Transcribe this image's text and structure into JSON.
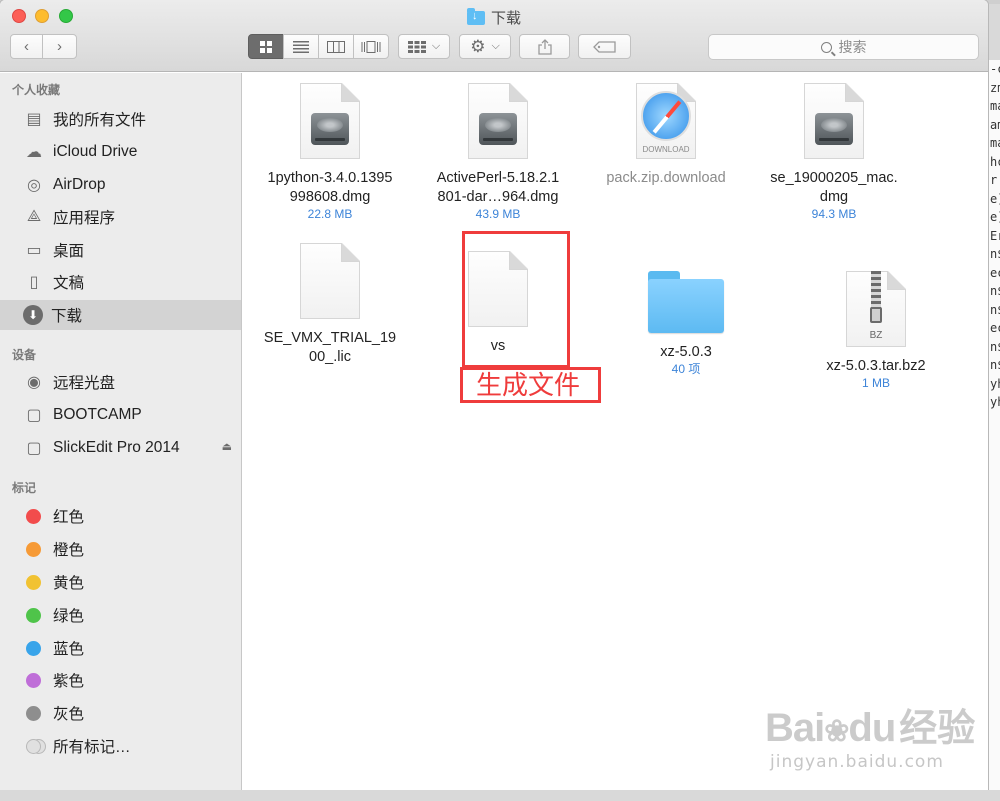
{
  "window": {
    "title": "下载"
  },
  "terminal_lines": [
    "",
    "",
    "",
    "-c",
    "zm",
    "ma",
    "am",
    "",
    "ma",
    "hc",
    "r",
    "e]",
    "e]",
    "Er",
    "n$",
    "ec",
    "n$",
    "",
    "n$",
    "ec",
    "n$",
    "",
    "n$",
    "yh",
    "yh"
  ],
  "search": {
    "placeholder": "搜索"
  },
  "sidebar": {
    "favorites_header": "个人收藏",
    "favorites": [
      {
        "label": "我的所有文件",
        "icon": "all-files-icon"
      },
      {
        "label": "iCloud Drive",
        "icon": "cloud-icon"
      },
      {
        "label": "AirDrop",
        "icon": "airdrop-icon"
      },
      {
        "label": "应用程序",
        "icon": "applications-icon"
      },
      {
        "label": "桌面",
        "icon": "desktop-icon"
      },
      {
        "label": "文稿",
        "icon": "documents-icon"
      },
      {
        "label": "下载",
        "icon": "download-icon",
        "selected": true
      }
    ],
    "devices_header": "设备",
    "devices": [
      {
        "label": "远程光盘",
        "icon": "disc-icon"
      },
      {
        "label": "BOOTCAMP",
        "icon": "drive-icon"
      },
      {
        "label": "SlickEdit Pro 2014",
        "icon": "drive-icon",
        "eject": true
      }
    ],
    "tags_header": "标记",
    "tags": [
      {
        "label": "红色",
        "color": "#f24c4c"
      },
      {
        "label": "橙色",
        "color": "#f69a36"
      },
      {
        "label": "黄色",
        "color": "#f1c232"
      },
      {
        "label": "绿色",
        "color": "#4fc44a"
      },
      {
        "label": "蓝色",
        "color": "#38a4ea"
      },
      {
        "label": "紫色",
        "color": "#bf6ed8"
      },
      {
        "label": "灰色",
        "color": "#8e8e8e"
      },
      {
        "label": "所有标记…",
        "color": ""
      }
    ]
  },
  "files": [
    {
      "name": "1python-3.4.0.1395\n998608.dmg",
      "meta": "22.8 MB",
      "kind": "dmg"
    },
    {
      "name": "ActivePerl-5.18.2.1\n801-dar…964.dmg",
      "meta": "43.9 MB",
      "kind": "dmg"
    },
    {
      "name": "pack.zip.download",
      "meta": "",
      "kind": "download",
      "dim": true,
      "badge": "DOWNLOAD"
    },
    {
      "name": "se_19000205_mac.\ndmg",
      "meta": "94.3 MB",
      "kind": "dmg"
    },
    {
      "name": "SE_VMX_TRIAL_19\n00_.lic",
      "meta": "",
      "kind": "doc"
    },
    {
      "name": "vs",
      "meta": "",
      "kind": "doc"
    },
    {
      "name": "xz-5.0.3",
      "meta": "40 项",
      "kind": "folder"
    },
    {
      "name": "xz-5.0.3.tar.bz2",
      "meta": "1 MB",
      "kind": "bz2",
      "badge": "BZ"
    }
  ],
  "annotation": {
    "label": "生成文件",
    "color": "#ef3c3c"
  },
  "watermark": {
    "brand": "Bai",
    "brand2": "du",
    "sub": "经验",
    "url": "jingyan.baidu.com"
  }
}
